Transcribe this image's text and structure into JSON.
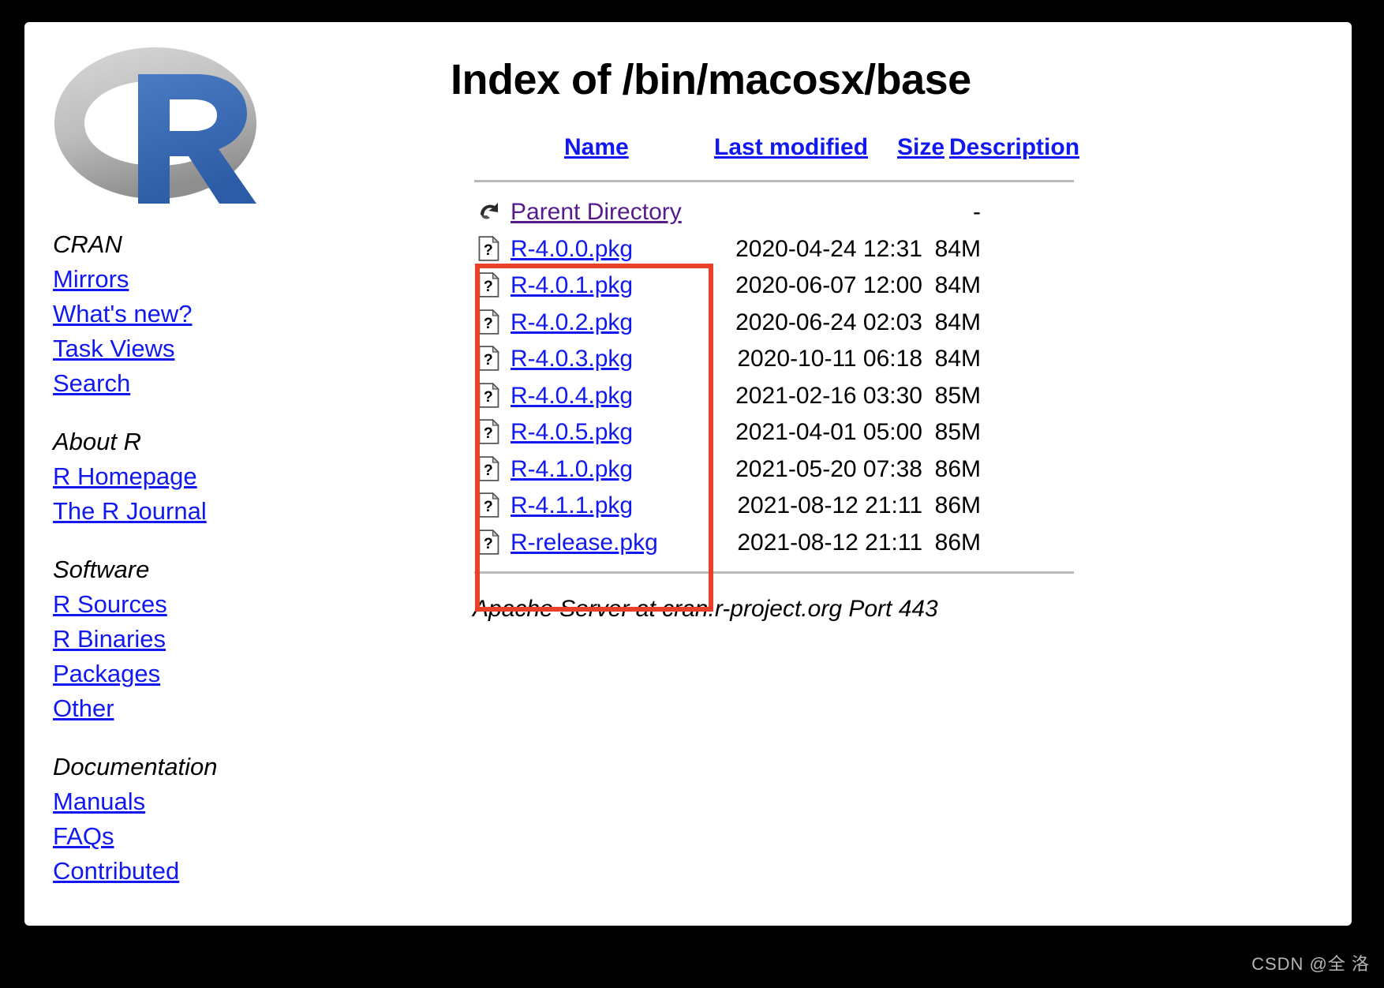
{
  "page": {
    "title": "Index of /bin/macosx/base",
    "footer": "Apache Server at cran.r-project.org Port 443",
    "watermark": "CSDN @全 洛",
    "highlight_color": "#e8412a",
    "link_color": "#1119ee",
    "visited_link_color": "#551a8b"
  },
  "logo": {
    "name": "r-project-logo",
    "letter": "R",
    "ring_color_light": "#cfcfcf",
    "ring_color_dark": "#9d9d9d",
    "letter_color": "#3b6ab4"
  },
  "sidebar": {
    "groups": [
      {
        "heading": "CRAN",
        "links": [
          {
            "label": "Mirrors",
            "icon": "link"
          },
          {
            "label": "What's new?",
            "icon": "link"
          },
          {
            "label": "Task Views",
            "icon": "link"
          },
          {
            "label": "Search",
            "icon": "link"
          }
        ]
      },
      {
        "heading": "About R",
        "links": [
          {
            "label": "R Homepage",
            "icon": "link"
          },
          {
            "label": "The R Journal",
            "icon": "link"
          }
        ]
      },
      {
        "heading": "Software",
        "links": [
          {
            "label": "R Sources",
            "icon": "link"
          },
          {
            "label": "R Binaries",
            "icon": "link"
          },
          {
            "label": "Packages",
            "icon": "link"
          },
          {
            "label": "Other",
            "icon": "link"
          }
        ]
      },
      {
        "heading": "Documentation",
        "links": [
          {
            "label": "Manuals",
            "icon": "link"
          },
          {
            "label": "FAQs",
            "icon": "link"
          },
          {
            "label": "Contributed",
            "icon": "link"
          }
        ]
      }
    ]
  },
  "listing": {
    "columns": {
      "name": "Name",
      "last_modified": "Last modified",
      "size": "Size",
      "description": "Description"
    },
    "parent": {
      "icon": "parent-directory-icon",
      "label": "Parent Directory",
      "last_modified": "",
      "size": "-",
      "description": ""
    },
    "files": [
      {
        "icon": "unknown-file-icon",
        "name": "R-4.0.0.pkg",
        "last_modified": "2020-04-24 12:31",
        "size": "84M",
        "description": ""
      },
      {
        "icon": "unknown-file-icon",
        "name": "R-4.0.1.pkg",
        "last_modified": "2020-06-07 12:00",
        "size": "84M",
        "description": ""
      },
      {
        "icon": "unknown-file-icon",
        "name": "R-4.0.2.pkg",
        "last_modified": "2020-06-24 02:03",
        "size": "84M",
        "description": ""
      },
      {
        "icon": "unknown-file-icon",
        "name": "R-4.0.3.pkg",
        "last_modified": "2020-10-11 06:18",
        "size": "84M",
        "description": ""
      },
      {
        "icon": "unknown-file-icon",
        "name": "R-4.0.4.pkg",
        "last_modified": "2021-02-16 03:30",
        "size": "85M",
        "description": ""
      },
      {
        "icon": "unknown-file-icon",
        "name": "R-4.0.5.pkg",
        "last_modified": "2021-04-01 05:00",
        "size": "85M",
        "description": ""
      },
      {
        "icon": "unknown-file-icon",
        "name": "R-4.1.0.pkg",
        "last_modified": "2021-05-20 07:38",
        "size": "86M",
        "description": ""
      },
      {
        "icon": "unknown-file-icon",
        "name": "R-4.1.1.pkg",
        "last_modified": "2021-08-12 21:11",
        "size": "86M",
        "description": ""
      },
      {
        "icon": "unknown-file-icon",
        "name": "R-release.pkg",
        "last_modified": "2021-08-12 21:11",
        "size": "86M",
        "description": ""
      }
    ]
  }
}
